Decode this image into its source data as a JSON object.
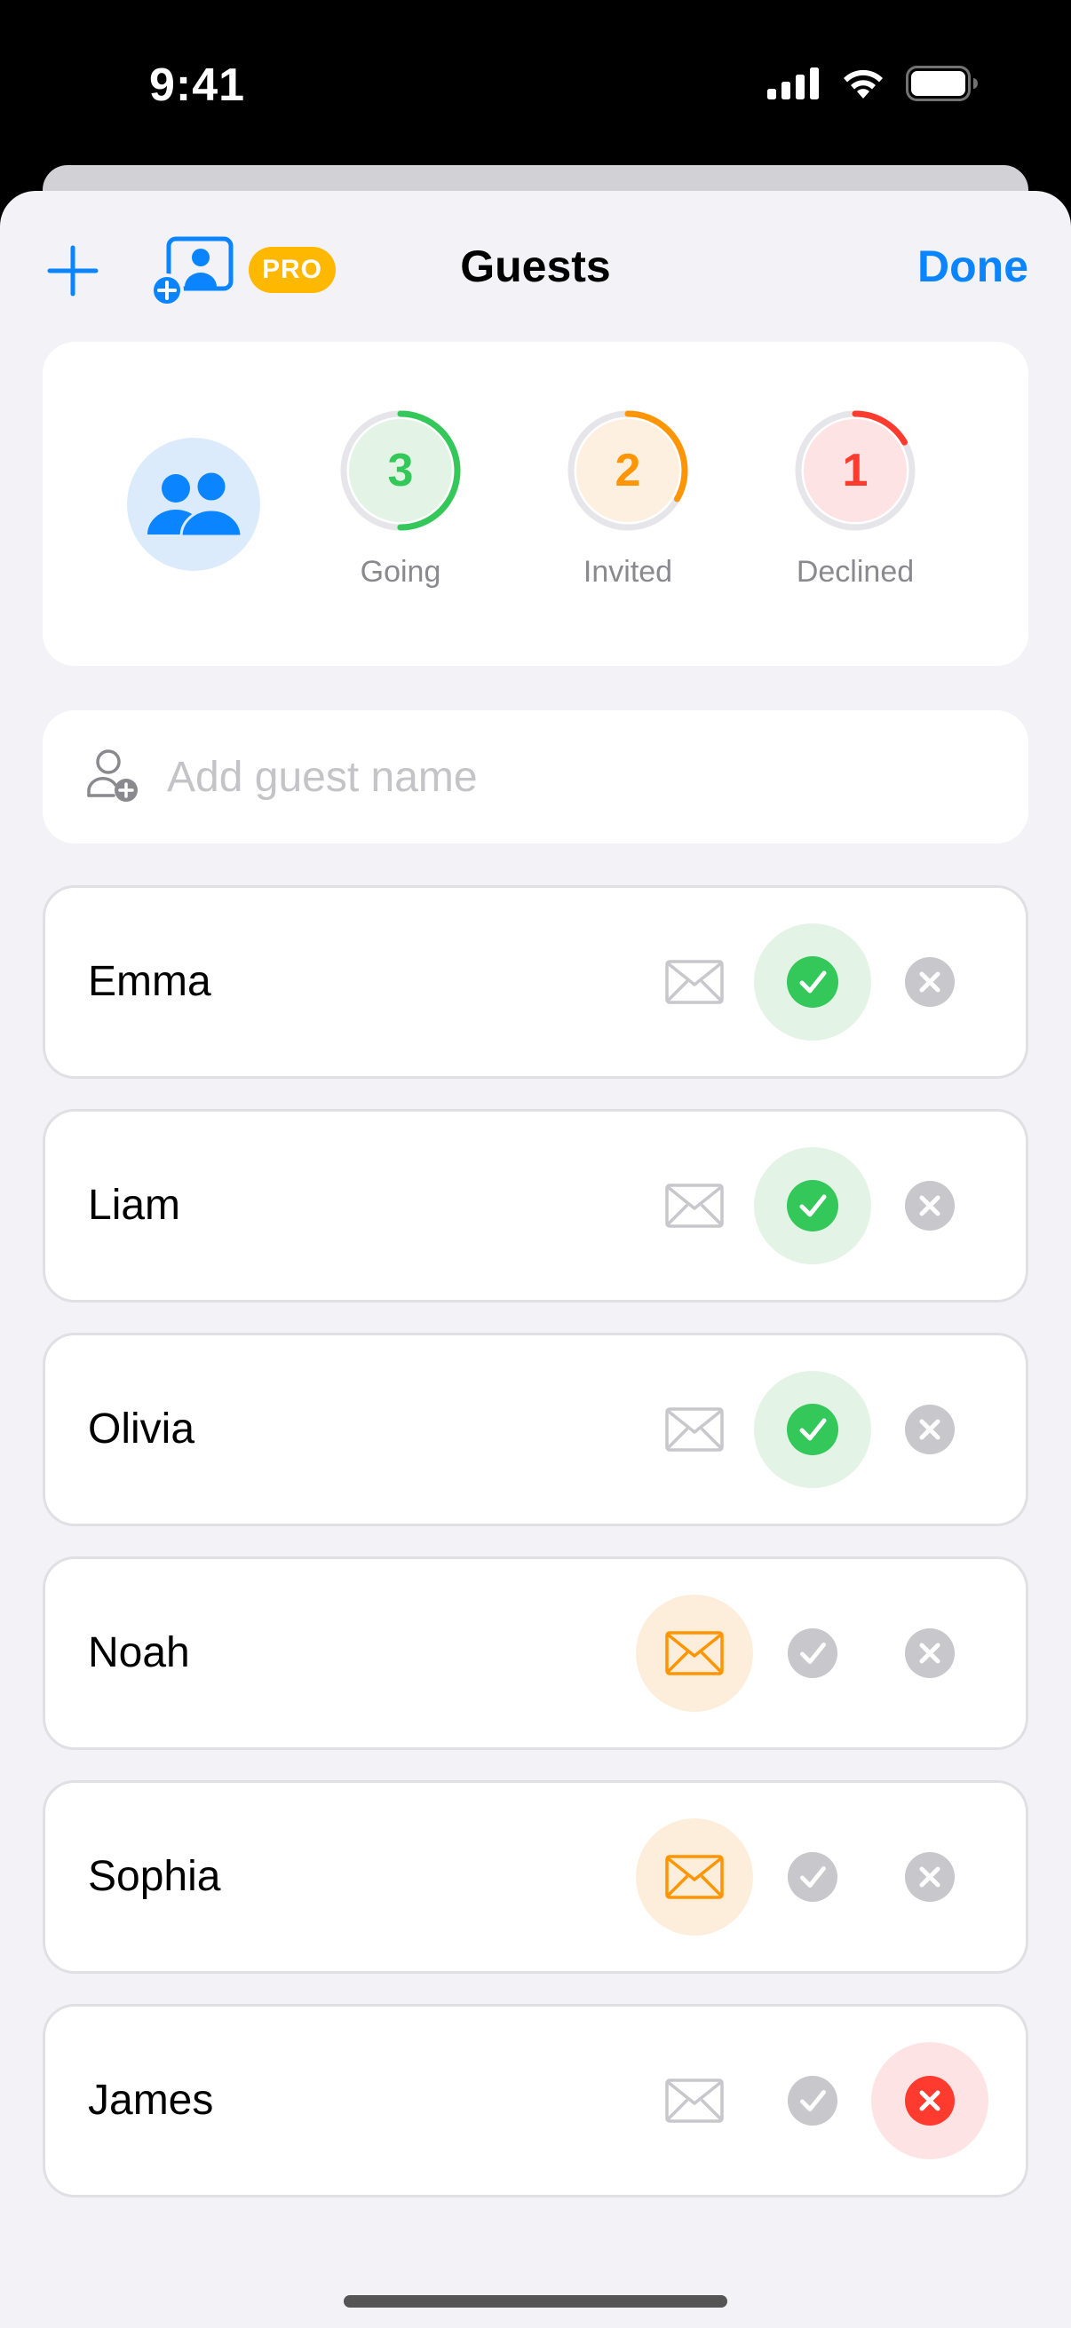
{
  "status_bar": {
    "time": "9:41"
  },
  "nav": {
    "title": "Guests",
    "done_label": "Done",
    "pro_badge": "PRO",
    "icons": {
      "add": "plus-icon",
      "import": "contact-add-icon"
    }
  },
  "stats": [
    {
      "count": "3",
      "label": "Going",
      "color": "#34c759",
      "bg": "#e3f4e6",
      "fraction": 0.5
    },
    {
      "count": "2",
      "label": "Invited",
      "color": "#ff9500",
      "bg": "#fdf0e0",
      "fraction": 0.333
    },
    {
      "count": "1",
      "label": "Declined",
      "color": "#ff3b30",
      "bg": "#fde3e3",
      "fraction": 0.167
    }
  ],
  "add_guest": {
    "placeholder": "Add guest name",
    "value": ""
  },
  "guests": [
    {
      "name": "Emma",
      "status": "going"
    },
    {
      "name": "Liam",
      "status": "going"
    },
    {
      "name": "Olivia",
      "status": "going"
    },
    {
      "name": "Noah",
      "status": "invited"
    },
    {
      "name": "Sophia",
      "status": "invited"
    },
    {
      "name": "James",
      "status": "declined"
    }
  ],
  "colors": {
    "accent": "#0a84ff",
    "going": "#34c759",
    "invited": "#ff9500",
    "declined": "#ff3b30",
    "inactive": "#c7c7cc"
  }
}
